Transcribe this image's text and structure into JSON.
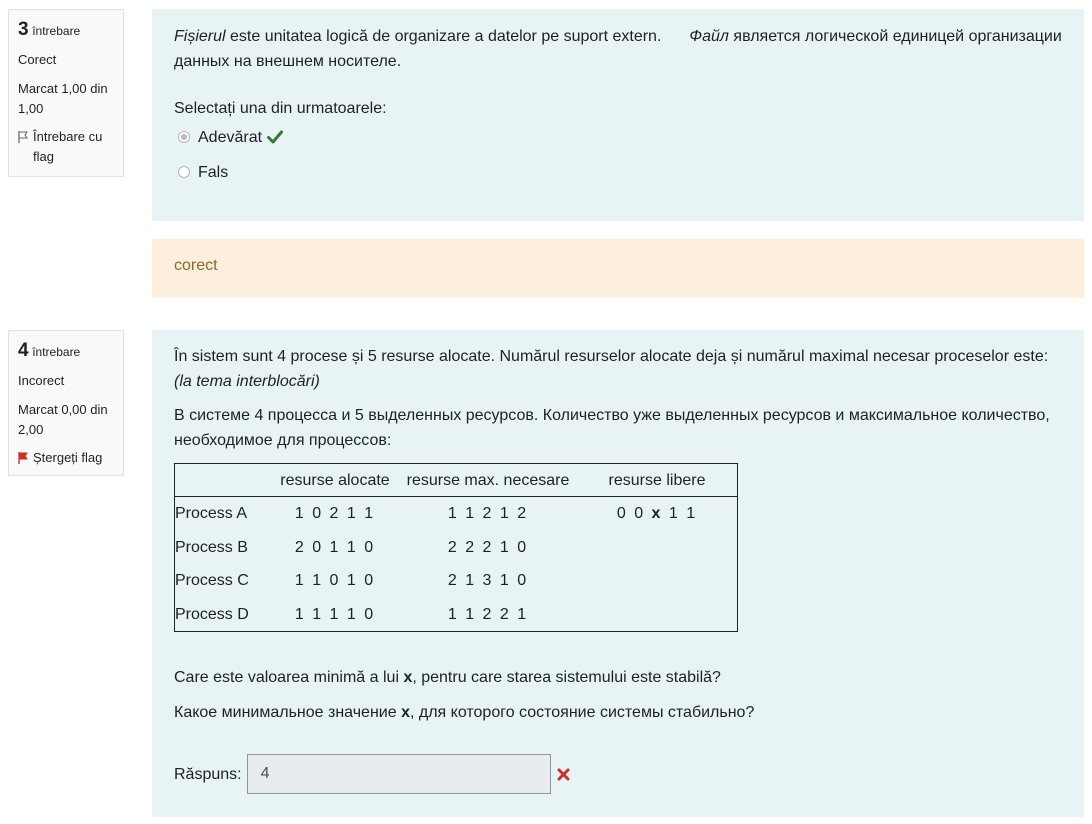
{
  "q3": {
    "number": "3",
    "word": "întrebare",
    "state": "Corect",
    "grade": "Marcat 1,00 din 1,00",
    "flag_label": "Întrebare cu flag",
    "text_italic": "Fișierul",
    "text_ro": " este unitatea logică de organizare a datelor pe suport extern.",
    "text_ru_italic": "Файл",
    "text_ru": " является логической единицей организации данных на внешнем носителе.",
    "prompt": "Selectați una din urmatoarele:",
    "options": [
      {
        "label": "Adevărat",
        "selected": true,
        "correct": true
      },
      {
        "label": "Fals",
        "selected": false
      }
    ],
    "feedback": "corect"
  },
  "q4": {
    "number": "4",
    "word": "întrebare",
    "state": "Incorect",
    "grade": "Marcat 0,00 din 2,00",
    "flag_label": "Ștergeți flag",
    "text_ro": "În sistem sunt 4 procese și 5 resurse alocate. Numărul resurselor alocate deja și numărul maximal necesar proceselor este:",
    "text_ro_note": "(la tema interblocări)",
    "text_ru": "В системе 4 процесса и 5 выделенных ресурсов. Количество уже выделенных ресурсов и максимальное количество, необходимое для процессов:",
    "table": {
      "headers": [
        "",
        "resurse alocate",
        "resurse max. necesare",
        "resurse libere"
      ],
      "rows": [
        {
          "name": "Process A",
          "alloc": "1 0 2 1 1",
          "max": "1 1 2 1 2",
          "free_a": "0 0 ",
          "free_x": "x",
          "free_b": " 1 1"
        },
        {
          "name": "Process B",
          "alloc": "2 0 1 1 0",
          "max": "2 2 2 1 0"
        },
        {
          "name": "Process C",
          "alloc": "1 1 0 1 0",
          "max": "2 1 3 1 0"
        },
        {
          "name": "Process D",
          "alloc": "1 1 1 1 0",
          "max": "1 1 2 2 1"
        }
      ]
    },
    "question_ro_a": "Care este valoarea minimă a lui ",
    "question_ro_x": "x",
    "question_ro_b": ", pentru care starea sistemului este stabilă?",
    "question_ru_a": "Какое минимальное значение ",
    "question_ru_x": "x",
    "question_ru_b": ", для которого состояние системы стабильно?",
    "answer_label": "Răspuns:",
    "answer_value": "4",
    "answer_correct": false
  },
  "colors": {
    "question_bg": "#e7f3f5",
    "feedback_bg": "#fcefdc",
    "correct": "#357a32",
    "incorrect": "#ca3120"
  }
}
